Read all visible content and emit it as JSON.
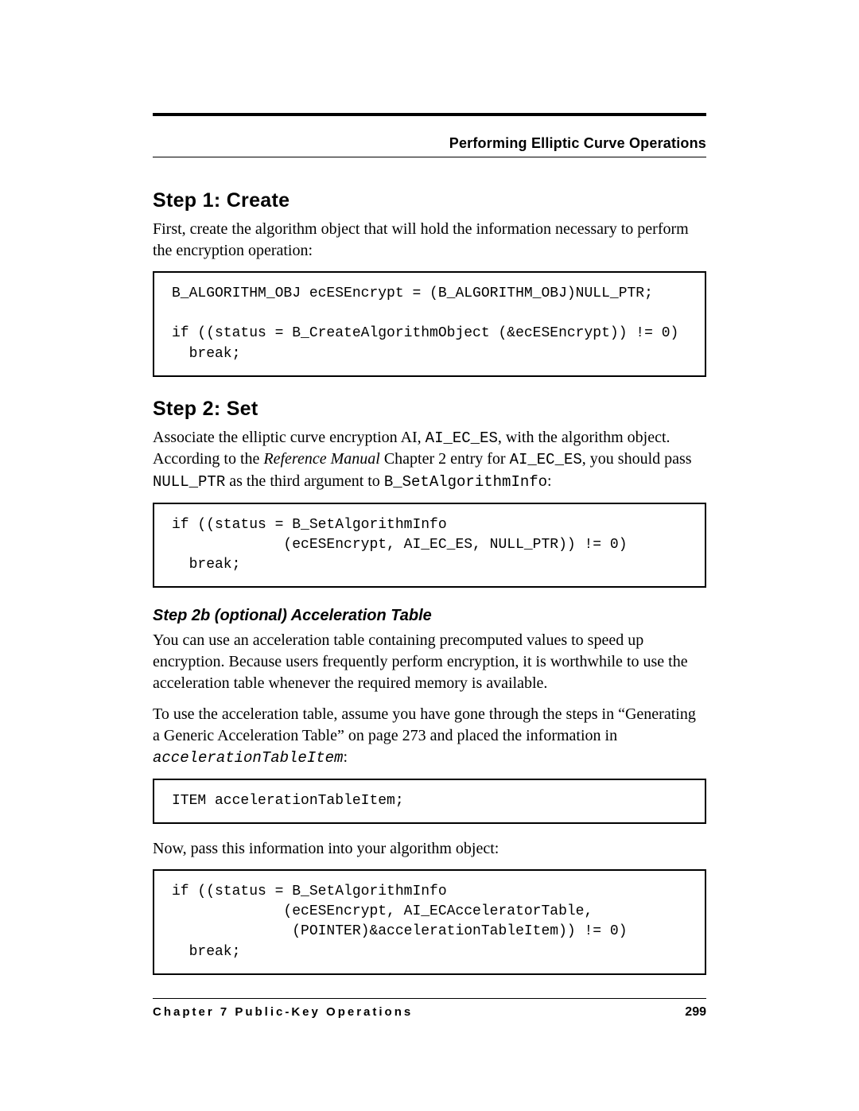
{
  "header": {
    "section_title": "Performing Elliptic Curve Operations"
  },
  "steps": {
    "step1": {
      "heading": "Step 1:  Create",
      "para1": "First, create the algorithm object that will hold the information necessary to perform the encryption operation:",
      "code": "B_ALGORITHM_OBJ ecESEncrypt = (B_ALGORITHM_OBJ)NULL_PTR;\n\nif ((status = B_CreateAlgorithmObject (&ecESEncrypt)) != 0)\n  break;"
    },
    "step2": {
      "heading": "Step 2:  Set",
      "para1_a": "Associate the elliptic curve encryption AI, ",
      "para1_code1": "AI_EC_ES",
      "para1_b": ", with the algorithm object. According to the ",
      "para1_ref": "Reference Manual",
      "para1_c": " Chapter 2 entry for ",
      "para1_code2": "AI_EC_ES",
      "para1_d": ", you should pass ",
      "para1_code3": "NULL_PTR",
      "para1_e": " as the third argument to ",
      "para1_code4": "B_SetAlgorithmInfo",
      "para1_f": ":",
      "code": "if ((status = B_SetAlgorithmInfo\n             (ecESEncrypt, AI_EC_ES, NULL_PTR)) != 0)\n  break;"
    },
    "step2b": {
      "heading": "Step 2b (optional)  Acceleration Table",
      "para1": "You can use an acceleration table containing precomputed values to speed up encryption. Because users frequently perform encryption, it is worthwhile to use the acceleration table whenever the required memory is available.",
      "para2_a": "To use the acceleration table, assume you have gone through the steps in “Generating a Generic Acceleration Table” on page 273 and placed the information in ",
      "para2_code": "accelerationTableItem",
      "para2_b": ":",
      "code1": "ITEM accelerationTableItem;",
      "para3": "Now, pass this information into your algorithm object:",
      "code2": "if ((status = B_SetAlgorithmInfo\n             (ecESEncrypt, AI_ECAcceleratorTable,\n              (POINTER)&accelerationTableItem)) != 0)\n  break;"
    }
  },
  "footer": {
    "chapter": "Chapter 7  Public-Key Operations",
    "page_number": "299"
  }
}
